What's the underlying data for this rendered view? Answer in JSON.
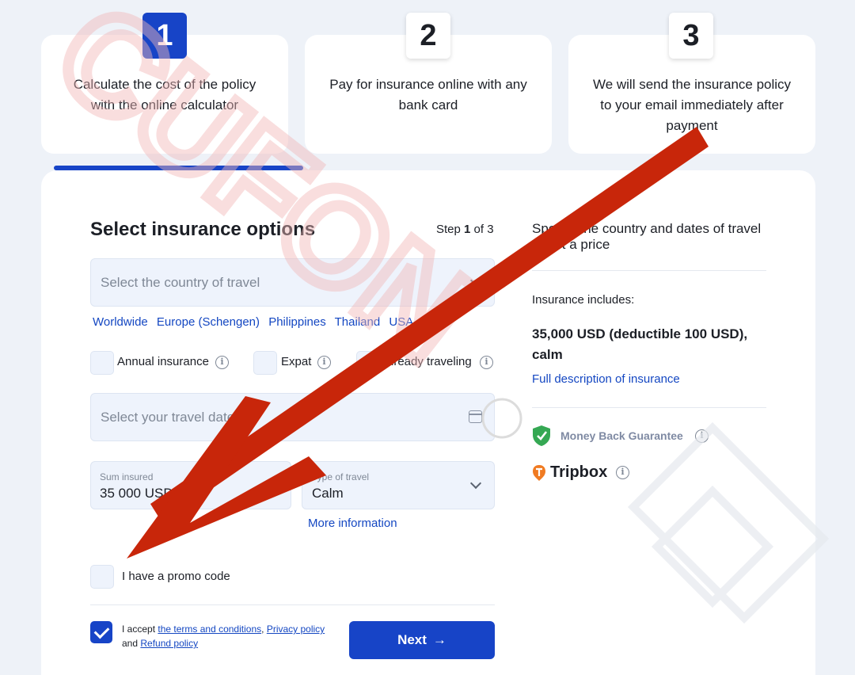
{
  "steps": [
    {
      "num": "1",
      "text": "Calculate the cost of the policy with the online calculator",
      "active": true
    },
    {
      "num": "2",
      "text": "Pay for insurance online with any bank card",
      "active": false
    },
    {
      "num": "3",
      "text": "We will send the insurance policy to your email immediately after payment",
      "active": false
    }
  ],
  "form": {
    "title": "Select insurance options",
    "step_prefix": "Step",
    "step_current": "1",
    "step_suffix": "of 3",
    "country_placeholder": "Select the country of travel",
    "quick_countries": [
      "Worldwide",
      "Europe (Schengen)",
      "Philippines",
      "Thailand",
      "USA"
    ],
    "options": [
      {
        "label": "Annual insurance"
      },
      {
        "label": "Expat"
      },
      {
        "label": "Already traveling"
      }
    ],
    "dates_placeholder": "Select your travel dates",
    "sum_insured_label": "Sum insured",
    "sum_insured_value": "35 000 USD",
    "travel_type_label": "Type of travel",
    "travel_type_value": "Calm",
    "more_info": "More information",
    "promo_label": "I have a promo code",
    "accept_prefix": "I accept",
    "terms_link": "the terms and conditions",
    "comma": ",",
    "privacy_link": "Privacy policy",
    "and_text": "and",
    "refund_link": "Refund policy",
    "next_label": "Next",
    "next_arrow": "→"
  },
  "summary": {
    "hint": "Specify the country and dates of travel to get a price",
    "includes_label": "Insurance includes:",
    "coverage": "35,000 USD (deductible 100 USD), calm",
    "full_description": "Full description of insurance",
    "money_back": "Money Back Guarantee",
    "tripbox": "Tripbox"
  },
  "overlay": {
    "watermark_text": "CUFON",
    "arrow_color": "#c8260a",
    "accent_color": "#1744c7"
  }
}
